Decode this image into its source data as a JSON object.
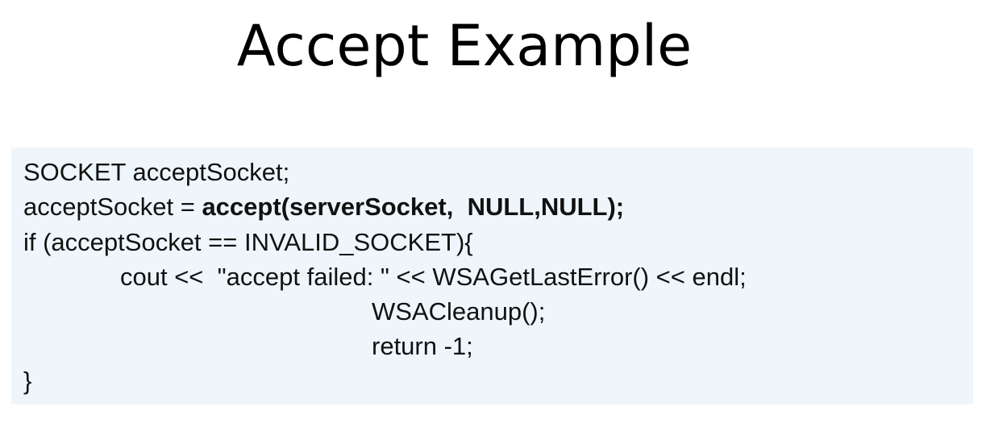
{
  "slide": {
    "title": "Accept Example"
  },
  "code": {
    "line1": "SOCKET acceptSocket;",
    "line2_prefix": "acceptSocket = ",
    "line2_bold": "accept(serverSocket,  NULL,NULL);",
    "line3": "if (acceptSocket == INVALID_SOCKET){",
    "line4": "cout <<  \"accept failed: \" << WSAGetLastError() << endl;",
    "line5": "WSACleanup();",
    "line6": "return -1;",
    "line7": "}"
  },
  "colors": {
    "code_background": "#eef6fb",
    "text": "#111111"
  }
}
